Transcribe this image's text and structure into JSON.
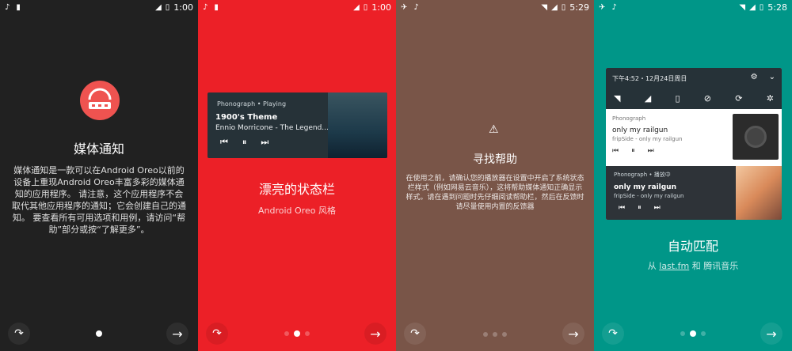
{
  "panels": [
    {
      "status": {
        "time": "1:00"
      },
      "title": "媒体通知",
      "description": "媒体通知是一款可以在Android Oreo以前的设备上重现Android Oreo丰富多彩的媒体通知的应用程序。 请注意，这个应用程序不会取代其他应用程序的通知；它会创建自己的通知。 要查看所有可用选项和用例，请访问“帮助”部分或按“了解更多”。"
    },
    {
      "status": {
        "time": "1:00"
      },
      "title": "漂亮的状态栏",
      "subtitle": "Android Oreo 风格",
      "notification": {
        "app_line": "Phonograph • Playing",
        "song": "1900's Theme",
        "artist": "Ennio Morricone - The Legend..."
      }
    },
    {
      "status": {
        "time": "5:29"
      },
      "title": "寻找帮助",
      "description": "在使用之前，请确认您的播放器在设置中开启了系统状态栏样式（例如网易云音乐），这将帮助媒体通知正确显示样式。请在遇到问题时先仔细阅读帮助栏，然后在反馈时请尽量使用内置的反馈器"
    },
    {
      "status": {
        "time": "5:28"
      },
      "title": "自动匹配",
      "subtitle_prefix": "从 ",
      "subtitle_link": "last.fm",
      "subtitle_suffix": " 和 腾讯音乐",
      "shade": {
        "date": "下午4:52・12月24日周日",
        "card1": {
          "app": "Phonograph",
          "title": "only my railgun",
          "artist": "fripSide - only my railgun"
        },
        "card2": {
          "app": "Phonograph • 播放中",
          "title": "only my railgun",
          "artist": "fripSide - only my railgun"
        }
      }
    }
  ],
  "icons": {
    "skip": "skip-arrow-icon",
    "next": "arrow-right-icon",
    "warning": "warning-icon"
  },
  "colors": {
    "panel1_bg": "#212121",
    "panel2_bg": "#ec2027",
    "panel3_bg": "#795548",
    "panel4_bg": "#009688",
    "logo": "#ef5350",
    "notification_bg": "#263238"
  }
}
